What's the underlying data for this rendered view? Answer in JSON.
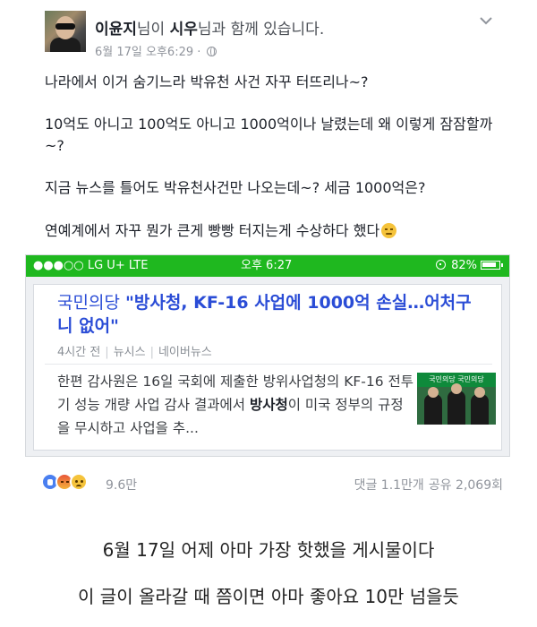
{
  "post": {
    "author": "이윤지",
    "author_suffix": "님이",
    "tagged": "시우",
    "tagged_suffix": "님과 함께 있습니다.",
    "timestamp": "6월 17일 오후6:29",
    "dot": "·",
    "privacy_icon": "globe-icon",
    "menu_icon": "chevron-down-icon",
    "paragraphs": [
      "나라에서 이거 숨기느라 박유천 사건 자꾸 터뜨리나~?",
      "10억도 아니고 100억도 아니고 1000억이나 날렸는데 왜 이렇게 잠잠할까~?",
      "지금 뉴스를 틀어도 박유천사건만 나오는데~? 세금 1000억은?",
      "연예계에서 자꾸 뭔가 큰게 빵빵 터지는게 수상하다 했다"
    ],
    "emoji_icon": "disappointed-face-icon"
  },
  "screenshot": {
    "status": {
      "carrier": "●●●○○ LG U+  LTE",
      "time": "오후 6:27",
      "battery": "82%",
      "location_icon": "location-icon",
      "battery_icon": "battery-icon",
      "bar_color": "#1fb81f"
    },
    "news": {
      "title_prefix": "국민의당 ",
      "title_bold": "\"방사청, KF-16 사업에 1000억 손실…어처구니 없어\"",
      "time": "4시간 전",
      "press": "뉴시스",
      "portal": "네이버뉴스",
      "snippet_a": "한편 감사원은 16일 국회에 제출한 방위사업청의 KF-16 전투기 성능 개량 사업 감사 결과에서 ",
      "snippet_bold": "방사청",
      "snippet_b": "이 미국 정부의 규정을 무시하고 사업을 추...",
      "thumb_banner": "국민의당 국민의당",
      "title_color": "#2a4cd6"
    }
  },
  "footer": {
    "reactions": [
      "like-icon",
      "angry-icon",
      "sad-icon"
    ],
    "reaction_count": "9.6만",
    "comments": "댓글 1.1만개",
    "shares": "공유 2,069회"
  },
  "captions": {
    "line1": "6월 17일 어제 아마 가장 핫했을 게시물이다",
    "line2": "이 글이 올라갈 때 쯤이면 아마 좋아요 10만 넘을듯"
  }
}
